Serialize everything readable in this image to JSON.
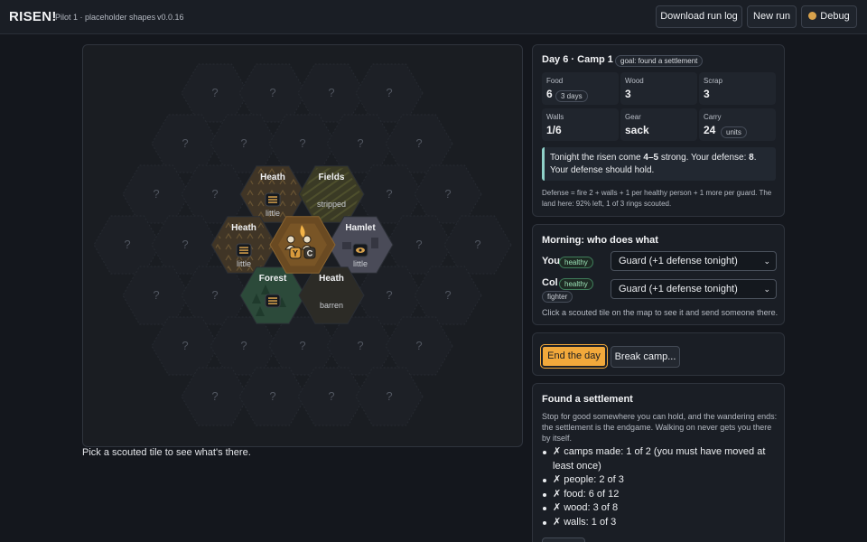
{
  "app": {
    "title": "RISEN!",
    "subtitle": "Pilot 1 · placeholder shapes",
    "version": "v0.0.16"
  },
  "toolbar": {
    "download_label": "Download run log",
    "new_run_label": "New run",
    "debug_label": "Debug"
  },
  "map": {
    "unknown_glyph": "?",
    "scouted": {
      "heath_n": {
        "name": "Heath",
        "note": "little"
      },
      "fields": {
        "name": "Fields",
        "note": "stripped"
      },
      "heath_w": {
        "name": "Heath",
        "note": "little"
      },
      "hamlet": {
        "name": "Hamlet",
        "note": "little"
      },
      "forest": {
        "name": "Forest",
        "note": ""
      },
      "heath_s": {
        "name": "Heath",
        "note": "barren"
      }
    },
    "tokens": [
      "Y",
      "C"
    ],
    "hint": "Pick a scouted tile to see what's there."
  },
  "camp": {
    "title": "Day 6 · Camp 1",
    "goal": "goal: found a settlement",
    "stats": {
      "food": {
        "label": "Food",
        "value": "6",
        "sub": "3 days"
      },
      "wood": {
        "label": "Wood",
        "value": "3"
      },
      "scrap": {
        "label": "Scrap",
        "value": "3"
      },
      "walls": {
        "label": "Walls",
        "value": "1/6"
      },
      "gear": {
        "label": "Gear",
        "value": "sack"
      },
      "carry": {
        "label": "Carry",
        "value": "24",
        "sub": "units"
      }
    },
    "tonight": {
      "t1": "Tonight the risen come ",
      "strength": "4–5",
      "t2": " strong. Your defense: ",
      "defense": "8",
      "t3": ".",
      "line2": "Your defense should hold."
    },
    "defense_note": "Defense = fire 2 + walls + 1 per healthy person + 1 more per guard. The land here: 92% left, 1 of 3 rings scouted."
  },
  "morning": {
    "title": "Morning: who does what",
    "people": [
      {
        "name": "You",
        "status": "healthy",
        "role": "",
        "assignment": "Guard (+1 defense tonight)"
      },
      {
        "name": "Col",
        "status": "healthy",
        "role": "fighter",
        "assignment": "Guard (+1 defense tonight)"
      }
    ],
    "hint": "Click a scouted tile on the map to see it and send someone there."
  },
  "actions": {
    "end_day_label": "End the day",
    "break_camp_label": "Break camp..."
  },
  "settlement": {
    "title": "Found a settlement",
    "description": "Stop for good somewhere you can hold, and the wandering ends: the settlement is the endgame. Walking on never gets you there by itself.",
    "mark": "✗",
    "requirements": [
      "camps made: 1 of 2 (you must have moved at least once)",
      "people: 2 of 3",
      "food: 6 of 12",
      "wood: 3 of 8",
      "walls: 1 of 3"
    ]
  },
  "colors": {
    "background": "#14171d",
    "panel": "#1a1e25",
    "accent": "#f2a93b",
    "healthy": "#9be0b5",
    "info_border": "#8fd1c9"
  }
}
